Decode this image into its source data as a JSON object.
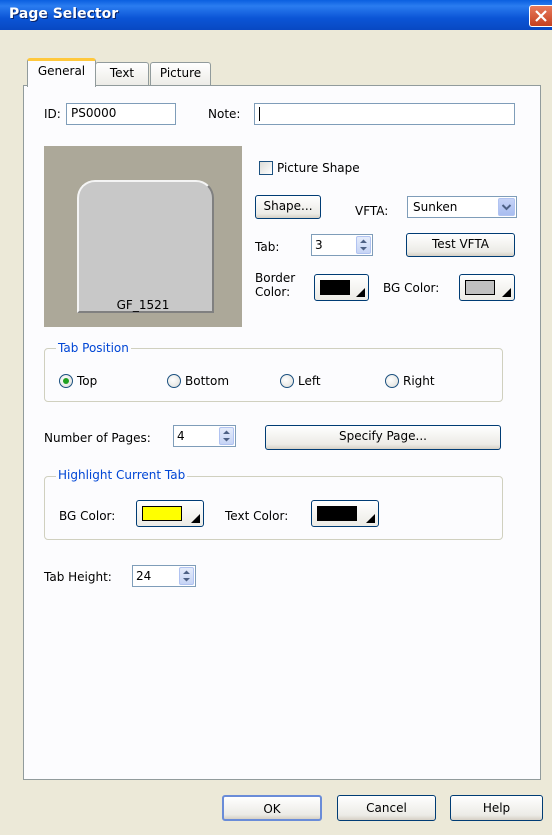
{
  "window": {
    "title": "Page Selector"
  },
  "tabs": [
    {
      "label": "General",
      "active": true
    },
    {
      "label": "Text",
      "active": false
    },
    {
      "label": "Picture",
      "active": false
    }
  ],
  "general": {
    "id_label": "ID:",
    "id_value": "PS0000",
    "note_label": "Note:",
    "note_value": "",
    "preview_caption": "GF_1521",
    "picture_shape_label": "Picture Shape",
    "picture_shape_checked": false,
    "shape_button": "Shape...",
    "vfta_label": "VFTA:",
    "vfta_value": "Sunken",
    "tab_label": "Tab:",
    "tab_value": "3",
    "test_vfta_button": "Test VFTA",
    "border_color_label_1": "Border",
    "border_color_label_2": "Color:",
    "border_color": "#000000",
    "bg_color_label": "BG Color:",
    "bg_color": "#c0c0c0"
  },
  "tab_position": {
    "legend": "Tab Position",
    "options": [
      {
        "label": "Top",
        "selected": true
      },
      {
        "label": "Bottom",
        "selected": false
      },
      {
        "label": "Left",
        "selected": false
      },
      {
        "label": "Right",
        "selected": false
      }
    ]
  },
  "pages": {
    "label": "Number of Pages:",
    "value": "4",
    "specify_button": "Specify Page..."
  },
  "highlight": {
    "legend": "Highlight Current Tab",
    "bg_color_label": "BG Color:",
    "bg_color": "#ffff00",
    "text_color_label": "Text Color:",
    "text_color": "#000000"
  },
  "tab_height": {
    "label": "Tab Height:",
    "value": "24"
  },
  "footer": {
    "ok": "OK",
    "cancel": "Cancel",
    "help": "Help"
  },
  "colors": {
    "accent": "#0046d5",
    "titlebar": "#0a5fe0"
  }
}
